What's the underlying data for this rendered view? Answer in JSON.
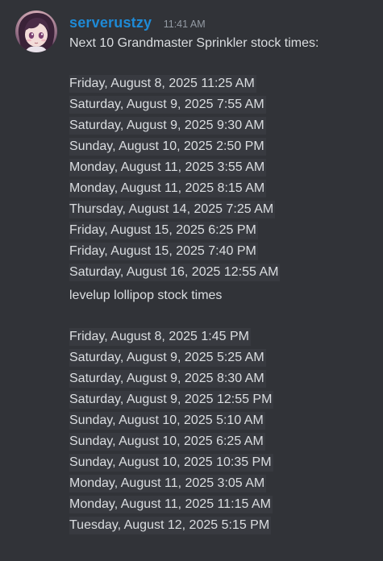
{
  "message": {
    "username": "serverustzy",
    "timestamp": "11:41 AM",
    "intro": "Next 10 Grandmaster Sprinkler stock times:",
    "sprinkler_times": [
      "Friday, August 8, 2025 11:25 AM",
      "Saturday, August 9, 2025 7:55 AM",
      "Saturday, August 9, 2025 9:30 AM",
      "Sunday, August 10, 2025 2:50 PM",
      "Monday, August 11, 2025 3:55 AM",
      "Monday, August 11, 2025 8:15 AM",
      "Thursday, August 14, 2025 7:25 AM",
      "Friday, August 15, 2025 6:25 PM",
      "Friday, August 15, 2025 7:40 PM",
      "Saturday, August 16, 2025 12:55 AM"
    ],
    "lollipop_heading": "levelup lollipop stock times",
    "lollipop_times": [
      "Friday, August 8, 2025 1:45 PM",
      "Saturday, August 9, 2025 5:25 AM",
      "Saturday, August 9, 2025 8:30 AM",
      "Saturday, August 9, 2025 12:55 PM",
      "Sunday, August 10, 2025 5:10 AM",
      "Sunday, August 10, 2025 6:25 AM",
      "Sunday, August 10, 2025 10:35 PM",
      "Monday, August 11, 2025 3:05 AM",
      "Monday, August 11, 2025 11:15 AM",
      "Tuesday, August 12, 2025 5:15 PM"
    ]
  },
  "colors": {
    "background": "#313338",
    "username": "#1e8ad6",
    "text": "#dbdee1",
    "timestamp": "#949ba4",
    "highlight": "#383a40"
  },
  "icons": {
    "avatar": "anime-character-avatar"
  }
}
